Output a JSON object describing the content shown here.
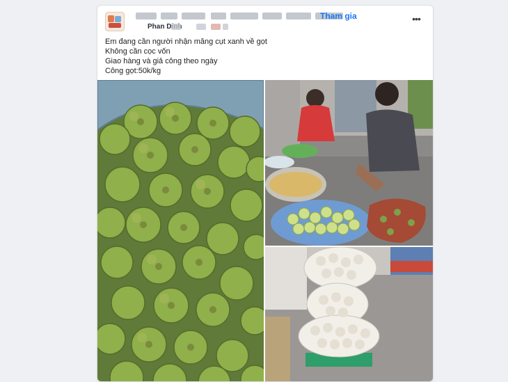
{
  "post": {
    "join_label": "Tham gia",
    "author": "Phan Dinh",
    "more_icon": "ellipsis-icon",
    "lines": [
      "Em đang cần người nhận măng cụt xanh về gọt",
      "Không cần cọc vốn",
      "Giao hàng và giả công theo ngày",
      "Công gọt:50k/kg"
    ]
  }
}
